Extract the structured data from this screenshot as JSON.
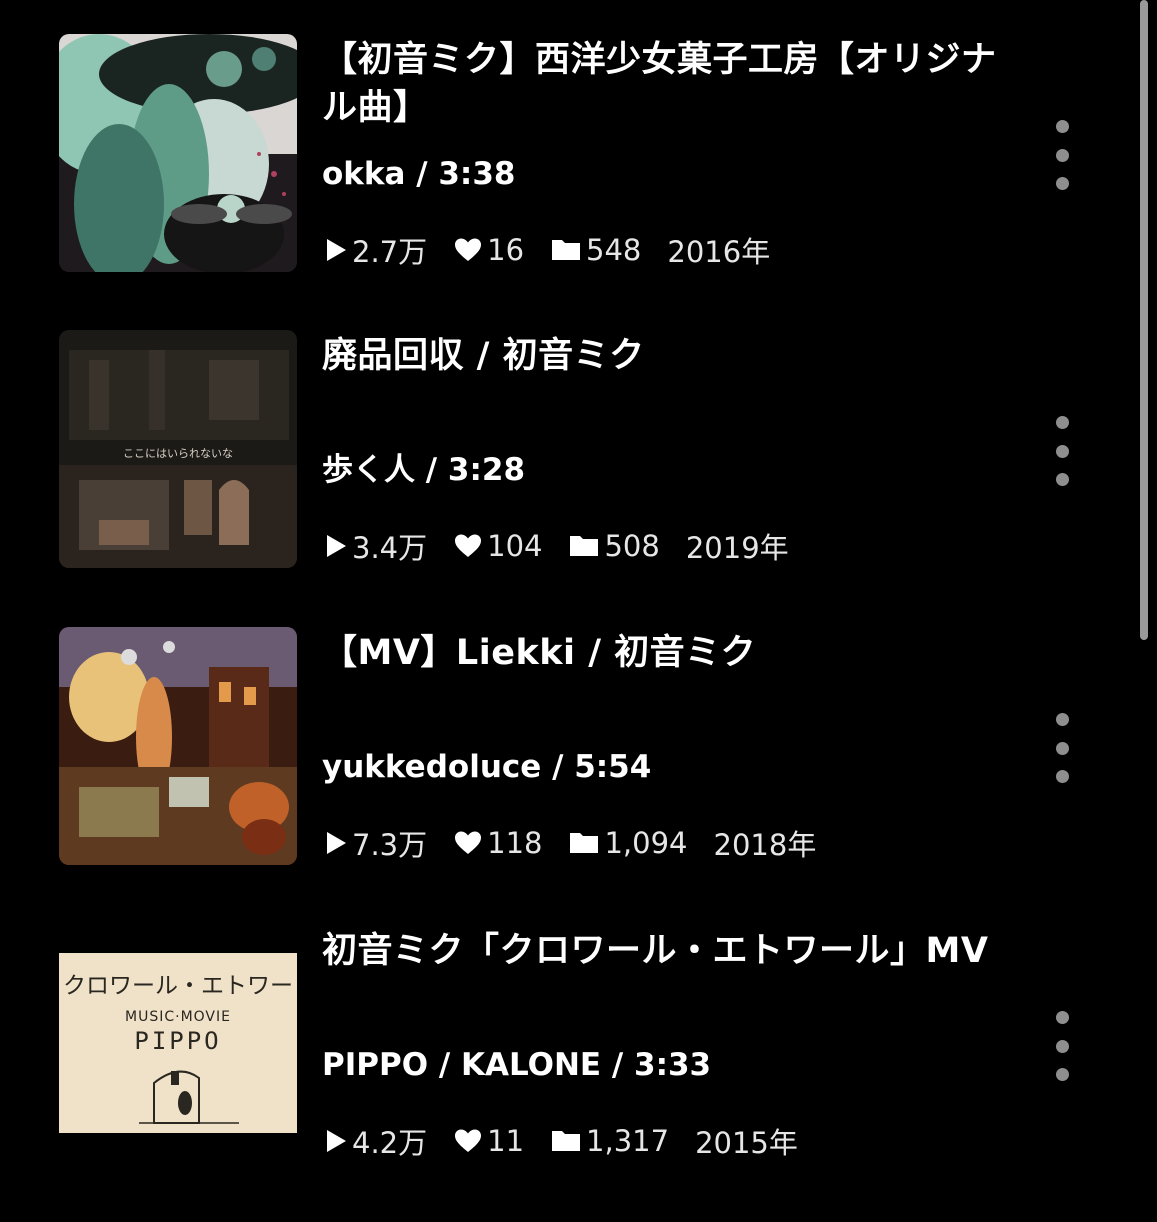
{
  "colors": {
    "background": "#000000",
    "title_text": "#ffffff",
    "stats_text": "#e6e6e6",
    "menu_dots": "#8e8e8e",
    "scrollbar": "#9a9a9a"
  },
  "videos": [
    {
      "title": "【初音ミク】西洋少女菓子工房【オリジナル曲】",
      "subtitle": "okka / 3:38",
      "views": "2.7万",
      "likes": "16",
      "mylists": "548",
      "year": "2016年",
      "thumbnail": "thumbnail-green-hair-witch-girl",
      "thumb_colors": [
        "#2c3d38",
        "#8fc5b3",
        "#d9e6e1"
      ]
    },
    {
      "title": "廃品回収 / 初音ミク",
      "subtitle": "歩く人 / 3:28",
      "views": "3.4万",
      "likes": "104",
      "mylists": "508",
      "year": "2019年",
      "thumbnail": "thumbnail-dark-ruined-house",
      "thumb_caption": "ここにはいられないな",
      "thumb_colors": [
        "#1c1a17",
        "#4a3f36",
        "#8c6e58"
      ]
    },
    {
      "title": "【MV】Liekki / 初音ミク",
      "subtitle": "yukkedoluce / 5:54",
      "views": "7.3万",
      "likes": "118",
      "mylists": "1,094",
      "year": "2018年",
      "thumbnail": "thumbnail-orange-painted-room",
      "thumb_colors": [
        "#3b1c10",
        "#c0612a",
        "#e9c27a"
      ]
    },
    {
      "title": "初音ミク「クロワール・エトワール」MV",
      "subtitle": "PIPPO / KALONE / 3:33",
      "views": "4.2万",
      "likes": "11",
      "mylists": "1,317",
      "year": "2015年",
      "thumbnail": "thumbnail-beige-pippo-card",
      "thumb_caption": "クロワール・エトワー",
      "thumb_caption2": "MUSIC·MOVIE",
      "thumb_caption3": "PIPPO",
      "thumb_colors": [
        "#efe2c8",
        "#3a332a",
        "#000000"
      ]
    }
  ],
  "icons": {
    "views": "play-icon",
    "likes": "heart-icon",
    "mylists": "folder-icon",
    "menu": "more-vertical-icon"
  }
}
